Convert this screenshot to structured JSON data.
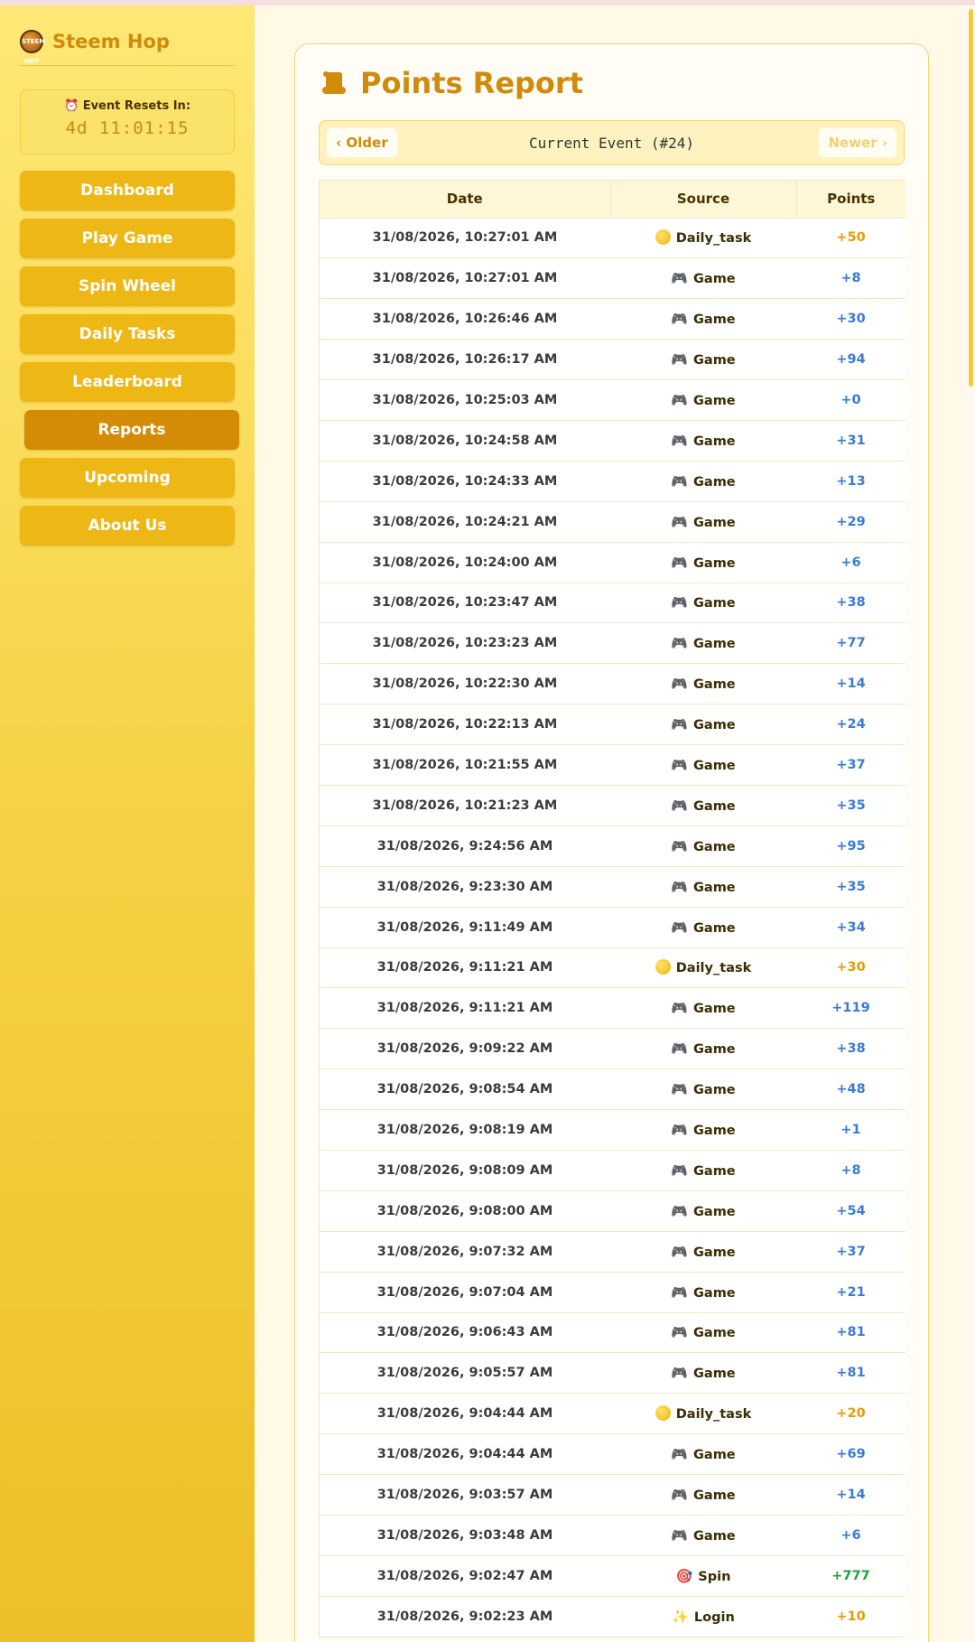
{
  "brand": {
    "name": "Steem Hop",
    "logo_text": "STEEM HOP"
  },
  "timer": {
    "label": "⏰ Event Resets In:",
    "value": "4d 11:01:15"
  },
  "nav": [
    {
      "label": "Dashboard",
      "active": false
    },
    {
      "label": "Play Game",
      "active": false
    },
    {
      "label": "Spin Wheel",
      "active": false
    },
    {
      "label": "Daily Tasks",
      "active": false
    },
    {
      "label": "Leaderboard",
      "active": false
    },
    {
      "label": "Reports",
      "active": true
    },
    {
      "label": "Upcoming",
      "active": false
    },
    {
      "label": "About Us",
      "active": false
    }
  ],
  "page": {
    "title": "Points Report",
    "older_label": "Older",
    "newer_label": "Newer",
    "event_label": "Current Event (#24)"
  },
  "table": {
    "headers": [
      "Date",
      "Source",
      "Points"
    ],
    "rows": [
      {
        "date": "31/08/2026, 10:27:01 AM",
        "source": "Daily_task",
        "type": "daily",
        "points": "+50"
      },
      {
        "date": "31/08/2026, 10:27:01 AM",
        "source": "Game",
        "type": "game",
        "points": "+8"
      },
      {
        "date": "31/08/2026, 10:26:46 AM",
        "source": "Game",
        "type": "game",
        "points": "+30"
      },
      {
        "date": "31/08/2026, 10:26:17 AM",
        "source": "Game",
        "type": "game",
        "points": "+94"
      },
      {
        "date": "31/08/2026, 10:25:03 AM",
        "source": "Game",
        "type": "game",
        "points": "+0"
      },
      {
        "date": "31/08/2026, 10:24:58 AM",
        "source": "Game",
        "type": "game",
        "points": "+31"
      },
      {
        "date": "31/08/2026, 10:24:33 AM",
        "source": "Game",
        "type": "game",
        "points": "+13"
      },
      {
        "date": "31/08/2026, 10:24:21 AM",
        "source": "Game",
        "type": "game",
        "points": "+29"
      },
      {
        "date": "31/08/2026, 10:24:00 AM",
        "source": "Game",
        "type": "game",
        "points": "+6"
      },
      {
        "date": "31/08/2026, 10:23:47 AM",
        "source": "Game",
        "type": "game",
        "points": "+38"
      },
      {
        "date": "31/08/2026, 10:23:23 AM",
        "source": "Game",
        "type": "game",
        "points": "+77"
      },
      {
        "date": "31/08/2026, 10:22:30 AM",
        "source": "Game",
        "type": "game",
        "points": "+14"
      },
      {
        "date": "31/08/2026, 10:22:13 AM",
        "source": "Game",
        "type": "game",
        "points": "+24"
      },
      {
        "date": "31/08/2026, 10:21:55 AM",
        "source": "Game",
        "type": "game",
        "points": "+37"
      },
      {
        "date": "31/08/2026, 10:21:23 AM",
        "source": "Game",
        "type": "game",
        "points": "+35"
      },
      {
        "date": "31/08/2026, 9:24:56 AM",
        "source": "Game",
        "type": "game",
        "points": "+95"
      },
      {
        "date": "31/08/2026, 9:23:30 AM",
        "source": "Game",
        "type": "game",
        "points": "+35"
      },
      {
        "date": "31/08/2026, 9:11:49 AM",
        "source": "Game",
        "type": "game",
        "points": "+34"
      },
      {
        "date": "31/08/2026, 9:11:21 AM",
        "source": "Daily_task",
        "type": "daily",
        "points": "+30"
      },
      {
        "date": "31/08/2026, 9:11:21 AM",
        "source": "Game",
        "type": "game",
        "points": "+119"
      },
      {
        "date": "31/08/2026, 9:09:22 AM",
        "source": "Game",
        "type": "game",
        "points": "+38"
      },
      {
        "date": "31/08/2026, 9:08:54 AM",
        "source": "Game",
        "type": "game",
        "points": "+48"
      },
      {
        "date": "31/08/2026, 9:08:19 AM",
        "source": "Game",
        "type": "game",
        "points": "+1"
      },
      {
        "date": "31/08/2026, 9:08:09 AM",
        "source": "Game",
        "type": "game",
        "points": "+8"
      },
      {
        "date": "31/08/2026, 9:08:00 AM",
        "source": "Game",
        "type": "game",
        "points": "+54"
      },
      {
        "date": "31/08/2026, 9:07:32 AM",
        "source": "Game",
        "type": "game",
        "points": "+37"
      },
      {
        "date": "31/08/2026, 9:07:04 AM",
        "source": "Game",
        "type": "game",
        "points": "+21"
      },
      {
        "date": "31/08/2026, 9:06:43 AM",
        "source": "Game",
        "type": "game",
        "points": "+81"
      },
      {
        "date": "31/08/2026, 9:05:57 AM",
        "source": "Game",
        "type": "game",
        "points": "+81"
      },
      {
        "date": "31/08/2026, 9:04:44 AM",
        "source": "Daily_task",
        "type": "daily",
        "points": "+20"
      },
      {
        "date": "31/08/2026, 9:04:44 AM",
        "source": "Game",
        "type": "game",
        "points": "+69"
      },
      {
        "date": "31/08/2026, 9:03:57 AM",
        "source": "Game",
        "type": "game",
        "points": "+14"
      },
      {
        "date": "31/08/2026, 9:03:48 AM",
        "source": "Game",
        "type": "game",
        "points": "+6"
      },
      {
        "date": "31/08/2026, 9:02:47 AM",
        "source": "Spin",
        "type": "spin",
        "points": "+777"
      },
      {
        "date": "31/08/2026, 9:02:23 AM",
        "source": "Login",
        "type": "login",
        "points": "+10"
      }
    ]
  },
  "icons": {
    "game": "game-controller-icon",
    "daily": "coin-icon",
    "spin": "target-icon",
    "login": "sparkles-icon"
  },
  "colors": {
    "accent": "#d08a0c",
    "nav_button": "#edb716",
    "nav_active": "#d48c06",
    "points_game": "#3a7bd5",
    "points_daily": "#e79c07",
    "points_spin": "#23a03a"
  }
}
